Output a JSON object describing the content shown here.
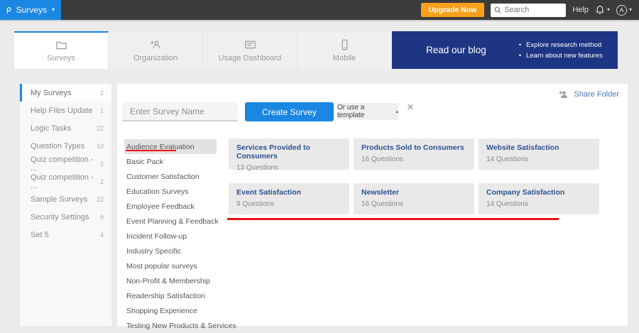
{
  "topbar": {
    "app_menu_label": "Surveys",
    "upgrade_label": "Upgrade Now",
    "search_placeholder": "Search",
    "help_label": "Help",
    "avatar_initial": "A"
  },
  "tabs": [
    {
      "label": "Surveys",
      "icon": "folder-icon",
      "active": true
    },
    {
      "label": "Organization",
      "icon": "add-user-icon"
    },
    {
      "label": "Usage Dashboard",
      "icon": "dashboard-icon"
    },
    {
      "label": "Mobile",
      "icon": "mobile-icon"
    }
  ],
  "banner": {
    "title": "Read our blog",
    "bullets": [
      "Explore research method",
      "Learn about new features"
    ]
  },
  "sidebar": {
    "items": [
      {
        "label": "My Surveys",
        "count": "2",
        "active": true
      },
      {
        "label": "Help Files Update",
        "count": "1"
      },
      {
        "label": "Logic Tasks",
        "count": "22"
      },
      {
        "label": "Question Types",
        "count": "10"
      },
      {
        "label": "Quiz competition - ...",
        "count": "2"
      },
      {
        "label": "Quiz competition - ...",
        "count": "2"
      },
      {
        "label": "Sample Surveys",
        "count": "22"
      },
      {
        "label": "Security Settings",
        "count": "9"
      },
      {
        "label": "Set 5",
        "count": "4"
      }
    ]
  },
  "main": {
    "share_folder_label": "Share Folder",
    "survey_name_placeholder": "Enter Survey Name",
    "create_button_label": "Create Survey",
    "template_dropdown_label": "Or use a template"
  },
  "templates": {
    "categories": [
      {
        "label": "Audience Evaluation",
        "active": true
      },
      {
        "label": "Basic Pack"
      },
      {
        "label": "Customer Satisfaction"
      },
      {
        "label": "Education Surveys"
      },
      {
        "label": "Employee Feedback"
      },
      {
        "label": "Event Planning & Feedback"
      },
      {
        "label": "Incident Follow-up"
      },
      {
        "label": "Industry Specific"
      },
      {
        "label": "Most popular surveys"
      },
      {
        "label": "Non-Profit & Membership"
      },
      {
        "label": "Readership Satisfaction"
      },
      {
        "label": "Shopping Experience"
      },
      {
        "label": "Testing New Products & Services"
      }
    ],
    "cards": [
      {
        "title": "Services Provided to Consumers",
        "questions": "13 Questions"
      },
      {
        "title": "Products Sold to Consumers",
        "questions": "16 Questions"
      },
      {
        "title": "Website Satisfaction",
        "questions": "14 Questions"
      },
      {
        "title": "Event Satisfaction",
        "questions": "9 Questions"
      },
      {
        "title": "Newsletter",
        "questions": "16 Questions"
      },
      {
        "title": "Company Satisfaction",
        "questions": "14 Questions"
      }
    ]
  },
  "icons": {
    "caret_down": "▾",
    "caret_up": "▴",
    "close": "×",
    "bullet": "•"
  },
  "colors": {
    "accent_blue": "#1a87e2",
    "banner_navy": "#1e3583",
    "upgrade_orange": "#f9a01b",
    "annotation_red": "#e8141c",
    "card_title_navy": "#2b5290",
    "topbar_dark": "#3b3b3b"
  }
}
